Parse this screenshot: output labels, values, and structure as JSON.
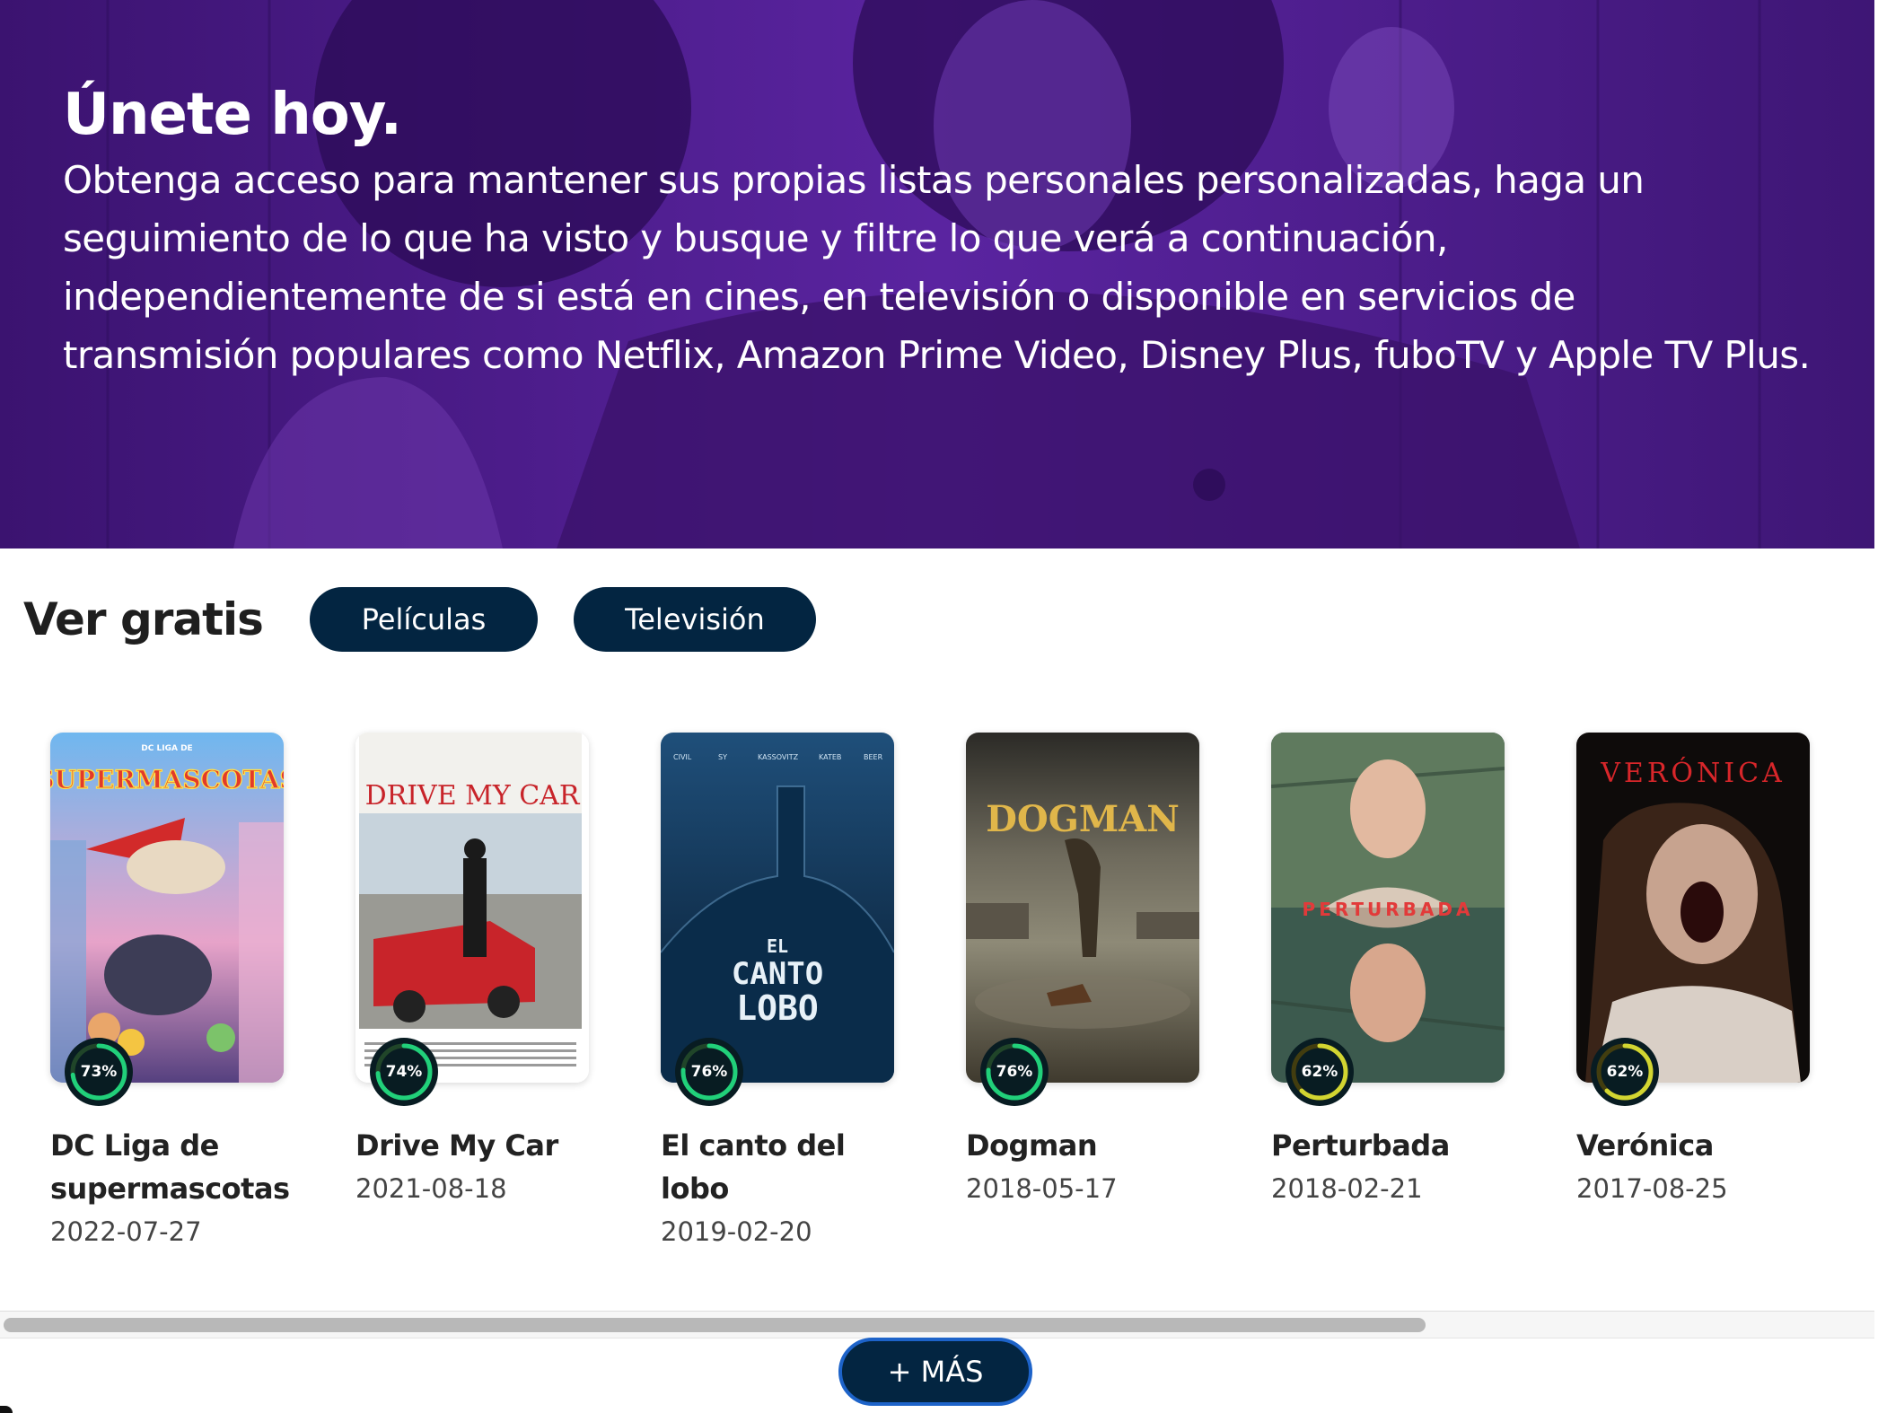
{
  "hero": {
    "title": "Únete hoy.",
    "description_lines": [
      "Obtenga acceso para mantener sus propias listas personales personalizadas, haga un",
      "seguimiento de lo que ha visto y busque y filtre lo que verá a continuación,",
      "independientemente de si está en cines, en televisión o disponible en servicios de",
      "transmisión populares como Netflix, Amazon Prime Video, Disney Plus, fuboTV y Apple TV Plus."
    ],
    "bg_color": "#4a1a86"
  },
  "free_section": {
    "title": "Ver gratis",
    "tabs": [
      {
        "label": "Películas",
        "selected": true
      },
      {
        "label": "Televisión",
        "selected": false
      }
    ]
  },
  "movies": [
    {
      "title": "DC Liga de supermascotas",
      "date": "2022-07-27",
      "score": "73%",
      "score_value": 73,
      "ring_color": "#21d07a",
      "poster_text": "SUPERMASCOTAS",
      "poster_subtext": "DC LIGA DE"
    },
    {
      "title": "Drive My Car",
      "date": "2021-08-18",
      "score": "74%",
      "score_value": 74,
      "ring_color": "#21d07a",
      "poster_text": "DRIVE MY CAR",
      "poster_subtext": ""
    },
    {
      "title": "El canto del lobo",
      "date": "2019-02-20",
      "score": "76%",
      "score_value": 76,
      "ring_color": "#21d07a",
      "poster_text": "CANTO",
      "poster_subtext": "EL",
      "poster_text2": "LOBO"
    },
    {
      "title": "Dogman",
      "date": "2018-05-17",
      "score": "76%",
      "score_value": 76,
      "ring_color": "#21d07a",
      "poster_text": "DOGMAN",
      "poster_subtext": ""
    },
    {
      "title": "Perturbada",
      "date": "2018-02-21",
      "score": "62%",
      "score_value": 62,
      "ring_color": "#d2d531",
      "poster_text": "PERTURBADA",
      "poster_subtext": ""
    },
    {
      "title": "Verónica",
      "date": "2017-08-25",
      "score": "62%",
      "score_value": 62,
      "ring_color": "#d2d531",
      "poster_text": "VERÓNICA",
      "poster_subtext": ""
    }
  ],
  "more_button": {
    "label": "+ MÁS"
  },
  "colors": {
    "primary_navy": "#032541",
    "score_bg": "#081c22",
    "score_green_track": "#204529",
    "score_yellow_track": "#423d0f"
  }
}
